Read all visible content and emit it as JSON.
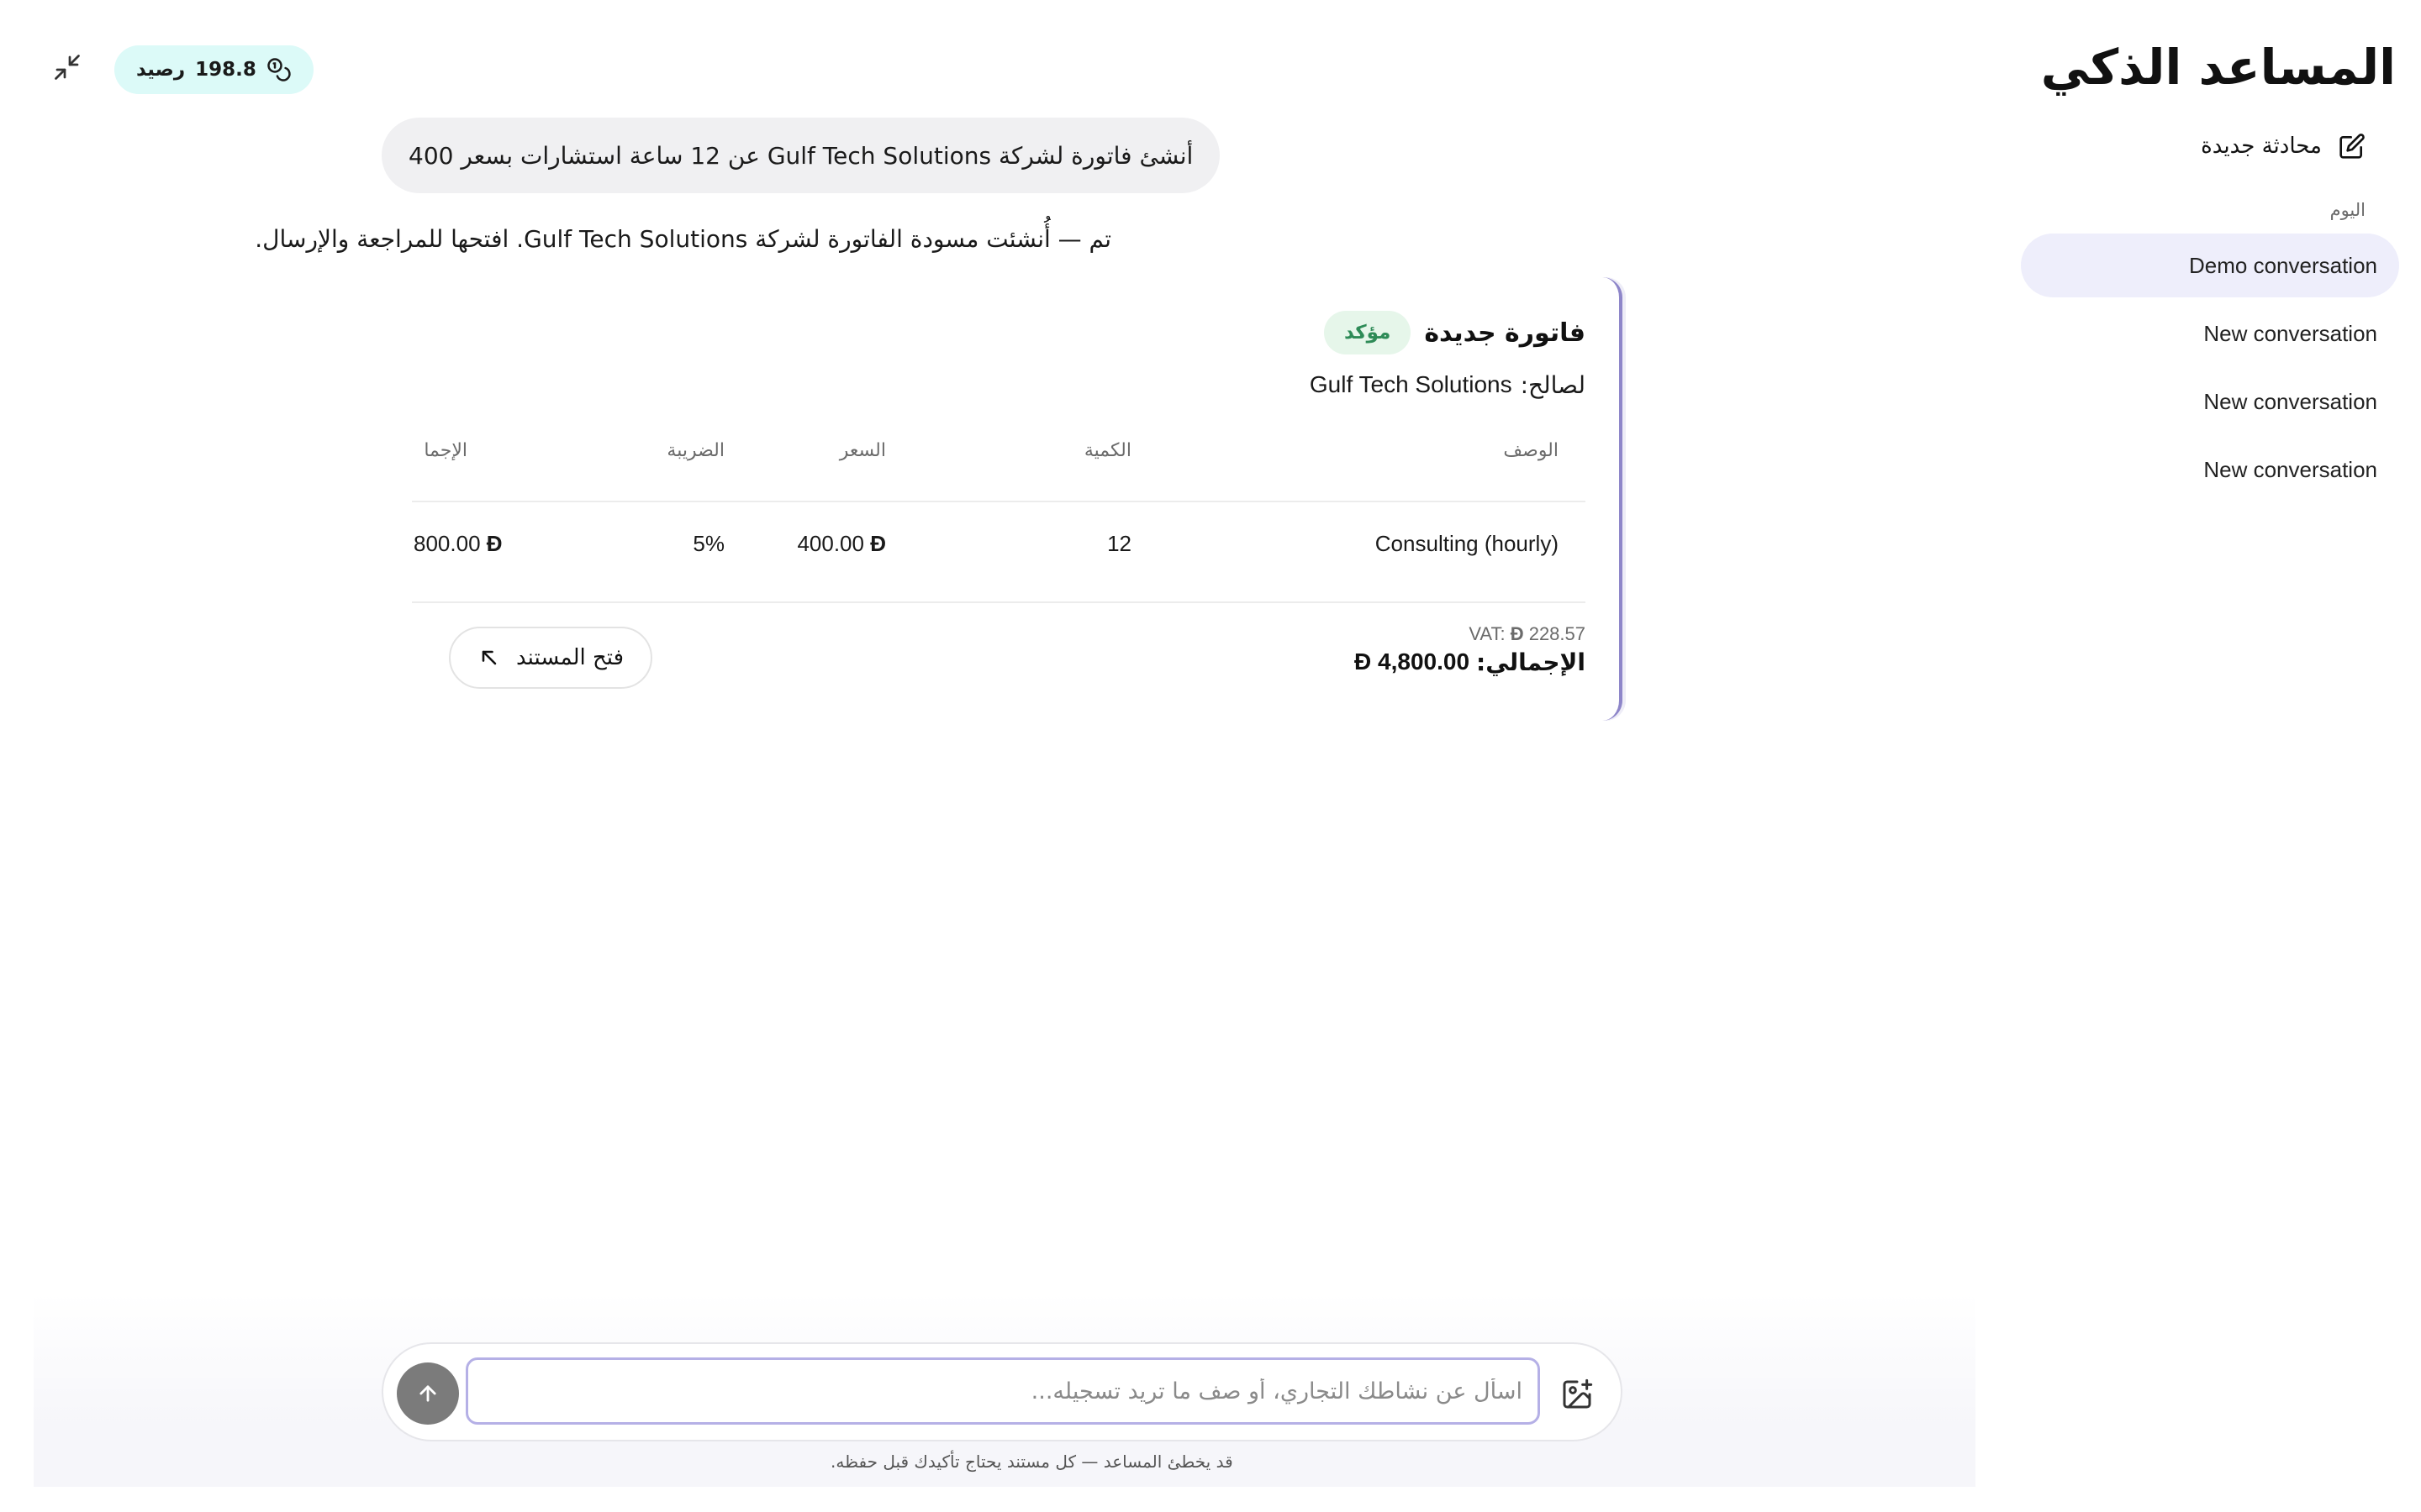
{
  "sidebar": {
    "title": "المساعد الذكي",
    "new_chat_label": "محادثة جديدة",
    "section_today": "اليوم",
    "conversations": [
      "Demo conversation",
      "New conversation",
      "New conversation",
      "New conversation"
    ]
  },
  "header": {
    "credit_value": "198.8",
    "credit_label": "رصيد"
  },
  "chat": {
    "user_message": "أنشئ فاتورة لشركة Gulf Tech Solutions عن 12 ساعة استشارات بسعر 400",
    "assistant_message": "تم — أُنشئت مسودة الفاتورة لشركة Gulf Tech Solutions. افتحها للمراجعة والإرسال."
  },
  "invoice": {
    "title": "فاتورة جديدة",
    "status": "مؤكد",
    "customer_prefix": "لصالح:",
    "customer_name": "Gulf Tech Solutions",
    "columns": {
      "description": "الوصف",
      "quantity": "الكمية",
      "price": "السعر",
      "tax": "الضريبة",
      "total": "الإجما"
    },
    "items": [
      {
        "description": "Consulting (hourly)",
        "quantity": "12",
        "price": "400.00",
        "tax": "5%",
        "total": "800.00"
      }
    ],
    "currency_symbol": "Đ",
    "vat_label": "VAT:",
    "vat_value": "228.57",
    "grand_total_label": "الإجمالي:",
    "grand_total_value": "4,800.00",
    "open_button_label": "فتح المستند"
  },
  "composer": {
    "placeholder": "اسأل عن نشاطك التجاري، أو صف ما تريد تسجيله...",
    "value": "",
    "disclaimer": "قد يخطئ المساعد — كل مستند يحتاج تأكيدك قبل حفظه."
  },
  "colors": {
    "accent": "#8e86c9",
    "active_item_bg": "#eeeefb",
    "credit_badge_bg": "#dcfaf8",
    "status_bg": "#e6f6ea",
    "status_text": "#2e8b57",
    "send_button": "#7b7b7b"
  }
}
